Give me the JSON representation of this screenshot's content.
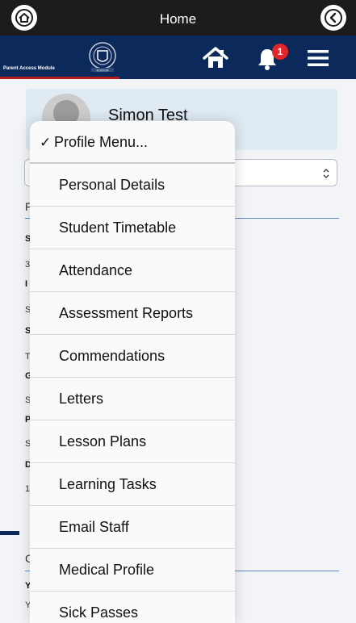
{
  "topbar": {
    "title": "Home"
  },
  "appbar": {
    "module_label": "Parent Access Module",
    "crest_label": "KOSTON",
    "notification_count": "1"
  },
  "profile": {
    "name": "Simon Test"
  },
  "background_letters": [
    "F",
    "S",
    "3",
    "I",
    "S",
    "S",
    "T",
    "G",
    "S",
    "P",
    "S",
    "D",
    "1",
    "C",
    "Y",
    "Y"
  ],
  "menu": {
    "selected_label": "Profile Menu...",
    "items": [
      "Personal Details",
      "Student Timetable",
      "Attendance",
      "Assessment Reports",
      "Commendations",
      "Letters",
      "Lesson Plans",
      "Learning Tasks",
      "Email Staff",
      "Medical Profile",
      "Sick Passes"
    ]
  },
  "colors": {
    "header_bg": "#0b2a5b",
    "accent_red": "#b31b1b",
    "badge_red": "#e0262b",
    "card_bg": "#dfeaf3"
  }
}
